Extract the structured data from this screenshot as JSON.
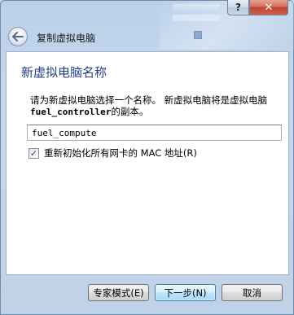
{
  "window": {
    "help_label": "?",
    "close_label": "✕"
  },
  "header": {
    "back_icon": "back-arrow-icon",
    "title": "复制虚拟电脑"
  },
  "page": {
    "title": "新虚拟电脑名称",
    "description_before": "请为新虚拟电脑选择一个名称。 新虚拟电脑将是虚拟电脑 ",
    "vm_name": "fuel_controller",
    "description_after": "的副本。"
  },
  "name_field": {
    "value": "fuel_compute"
  },
  "reinit_mac": {
    "checked": true,
    "check_mark": "✓",
    "label": "重新初始化所有网卡的 MAC 地址(R)"
  },
  "buttons": {
    "expert": "专家模式(E)",
    "next": "下一步(N)",
    "cancel": "取消"
  }
}
